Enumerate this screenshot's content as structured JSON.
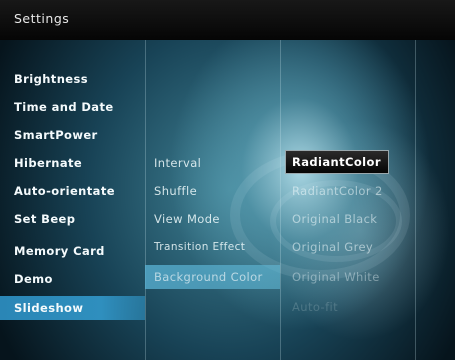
{
  "header": {
    "title": "Settings"
  },
  "menu_left": [
    "Brightness",
    "Time and Date",
    "SmartPower",
    "Hibernate",
    "Auto-orientate",
    "Set Beep",
    "Memory Card",
    "Demo",
    "Slideshow"
  ],
  "menu_left_selected": "Slideshow",
  "menu_mid": [
    "Interval",
    "Shuffle",
    "View Mode",
    "Transition Effect",
    "Background Color"
  ],
  "menu_mid_selected": "Background Color",
  "menu_right": [
    "RadiantColor",
    "RadiantColor 2",
    "Original Black",
    "Original Grey",
    "Original White",
    "Auto-fit"
  ],
  "menu_right_selected": "RadiantColor",
  "colors": {
    "header_bg": "#0a0a0a",
    "selection_blue": "#2f8fbe",
    "selection_dark": "#111111"
  }
}
